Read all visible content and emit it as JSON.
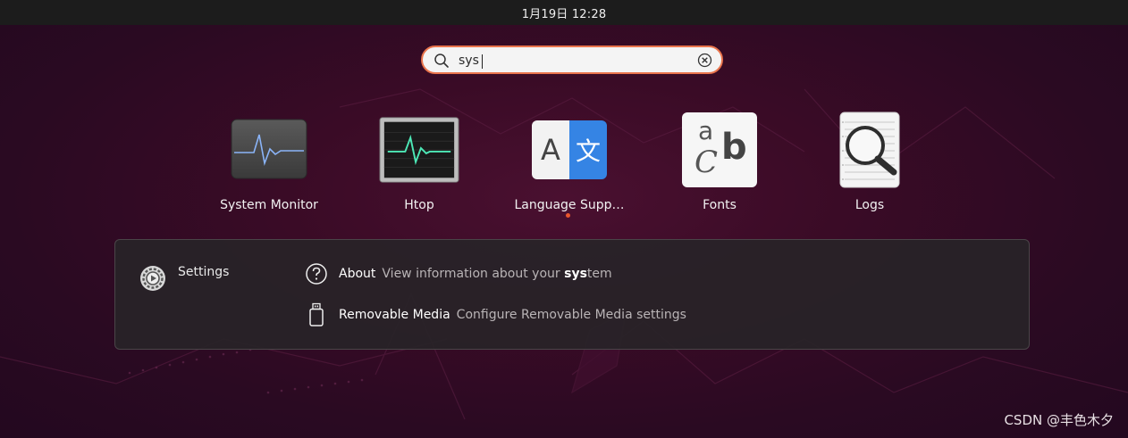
{
  "topbar": {
    "clock": "1月19日  12:28"
  },
  "search": {
    "value": "sys",
    "icon": "magnifier-icon",
    "clear_icon": "clear-circle-icon"
  },
  "apps": [
    {
      "label": "System Monitor",
      "icon": "system-monitor-icon"
    },
    {
      "label": "Htop",
      "icon": "htop-terminal-icon"
    },
    {
      "label": "Language Supp…",
      "icon": "language-support-icon",
      "running": true
    },
    {
      "label": "Fonts",
      "icon": "fonts-icon"
    },
    {
      "label": "Logs",
      "icon": "logs-icon"
    }
  ],
  "language_icon": {
    "left_glyph": "A",
    "right_glyph": "文"
  },
  "fonts_icon": {
    "a": "a",
    "b": "b",
    "c": "C"
  },
  "settings_provider": {
    "label": "Settings",
    "icon": "settings-gear-icon",
    "results": [
      {
        "title": "About",
        "desc_bold": "sys",
        "desc_prefix": "View information about your ",
        "desc_suffix": "tem",
        "icon": "question-circle-icon"
      },
      {
        "title": "Removable Media",
        "desc": "Configure Removable Media settings",
        "icon": "usb-drive-icon"
      }
    ]
  },
  "watermark": "CSDN @丰色木夕",
  "colors": {
    "accent": "#e9744c",
    "panel_bg": "#1c1c1c",
    "running_dot": "#e9552c"
  }
}
